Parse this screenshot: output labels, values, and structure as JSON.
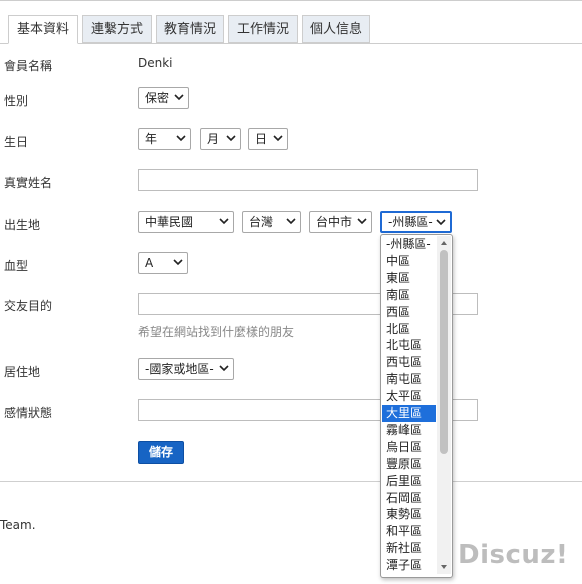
{
  "tabs": [
    {
      "label": "基本資料",
      "active": true
    },
    {
      "label": "連繫方式",
      "active": false
    },
    {
      "label": "教育情況",
      "active": false
    },
    {
      "label": "工作情況",
      "active": false
    },
    {
      "label": "個人信息",
      "active": false
    }
  ],
  "form": {
    "username": {
      "label": "會員名稱",
      "value": "Denki"
    },
    "gender": {
      "label": "性別",
      "value": "保密"
    },
    "birthday": {
      "label": "生日",
      "year": "年",
      "month": "月",
      "day": "日"
    },
    "realname": {
      "label": "真實姓名",
      "value": ""
    },
    "birthplace": {
      "label": "出生地",
      "country": "中華民國",
      "province": "台灣",
      "city": "台中市",
      "district": "-州縣區-"
    },
    "bloodtype": {
      "label": "血型",
      "value": "A"
    },
    "lookingfor": {
      "label": "交友目的",
      "value": "",
      "hint": "希望在網站找到什麼樣的朋友"
    },
    "residence": {
      "label": "居住地",
      "value": "-國家或地區-"
    },
    "affective": {
      "label": "感情狀態",
      "value": ""
    },
    "save_label": "儲存"
  },
  "dropdown": {
    "options": [
      "-州縣區-",
      "中區",
      "東區",
      "南區",
      "西區",
      "北區",
      "北屯區",
      "西屯區",
      "南屯區",
      "太平區",
      "大里區",
      "霧峰區",
      "烏日區",
      "豐原區",
      "后里區",
      "石岡區",
      "東勢區",
      "和平區",
      "新社區",
      "潭子區"
    ],
    "selected_index": 10
  },
  "footer": {
    "team_text": "Team.",
    "logo_text": "Discuz!"
  },
  "colors": {
    "accent": "#1764c4",
    "tab_bg": "#e8edf3",
    "highlight": "#1e6fdb"
  }
}
